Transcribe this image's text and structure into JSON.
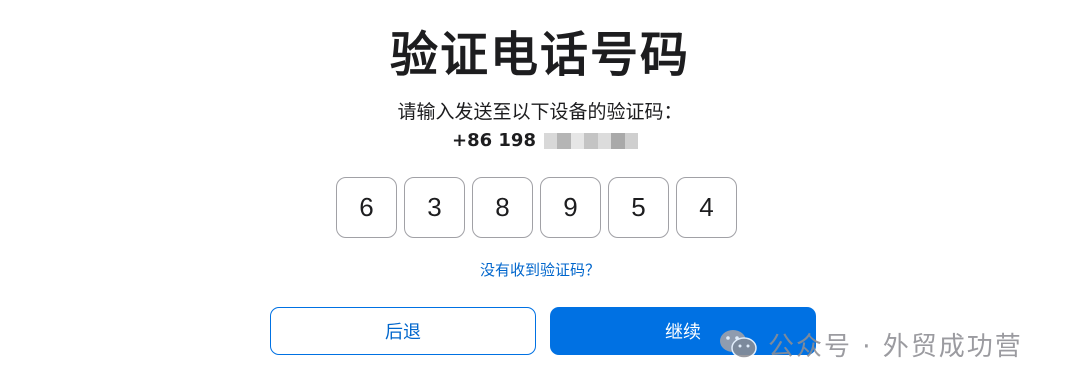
{
  "page": {
    "title": "验证电话号码",
    "instruction": "请输入发送至以下设备的验证码：",
    "phone_number_visible": "+86 198",
    "phone_mask_colors": [
      "#d8d8d8",
      "#b5b5b5",
      "#e6e6e6",
      "#c4c4c4",
      "#dcdcdc",
      "#a9a9a9",
      "#cfcfcf"
    ]
  },
  "code": {
    "digits": [
      "6",
      "3",
      "8",
      "9",
      "5",
      "4"
    ]
  },
  "links": {
    "resend": "没有收到验证码？"
  },
  "buttons": {
    "back": "后退",
    "continue": "继续"
  },
  "watermark": {
    "text": "公众号 · 外贸成功营",
    "icon": "wechat-icon"
  },
  "colors": {
    "accent": "#0071e3",
    "link": "#0066cc",
    "text": "#1d1d1f",
    "border": "#a1a1a6",
    "watermark": "#8e8e93"
  }
}
